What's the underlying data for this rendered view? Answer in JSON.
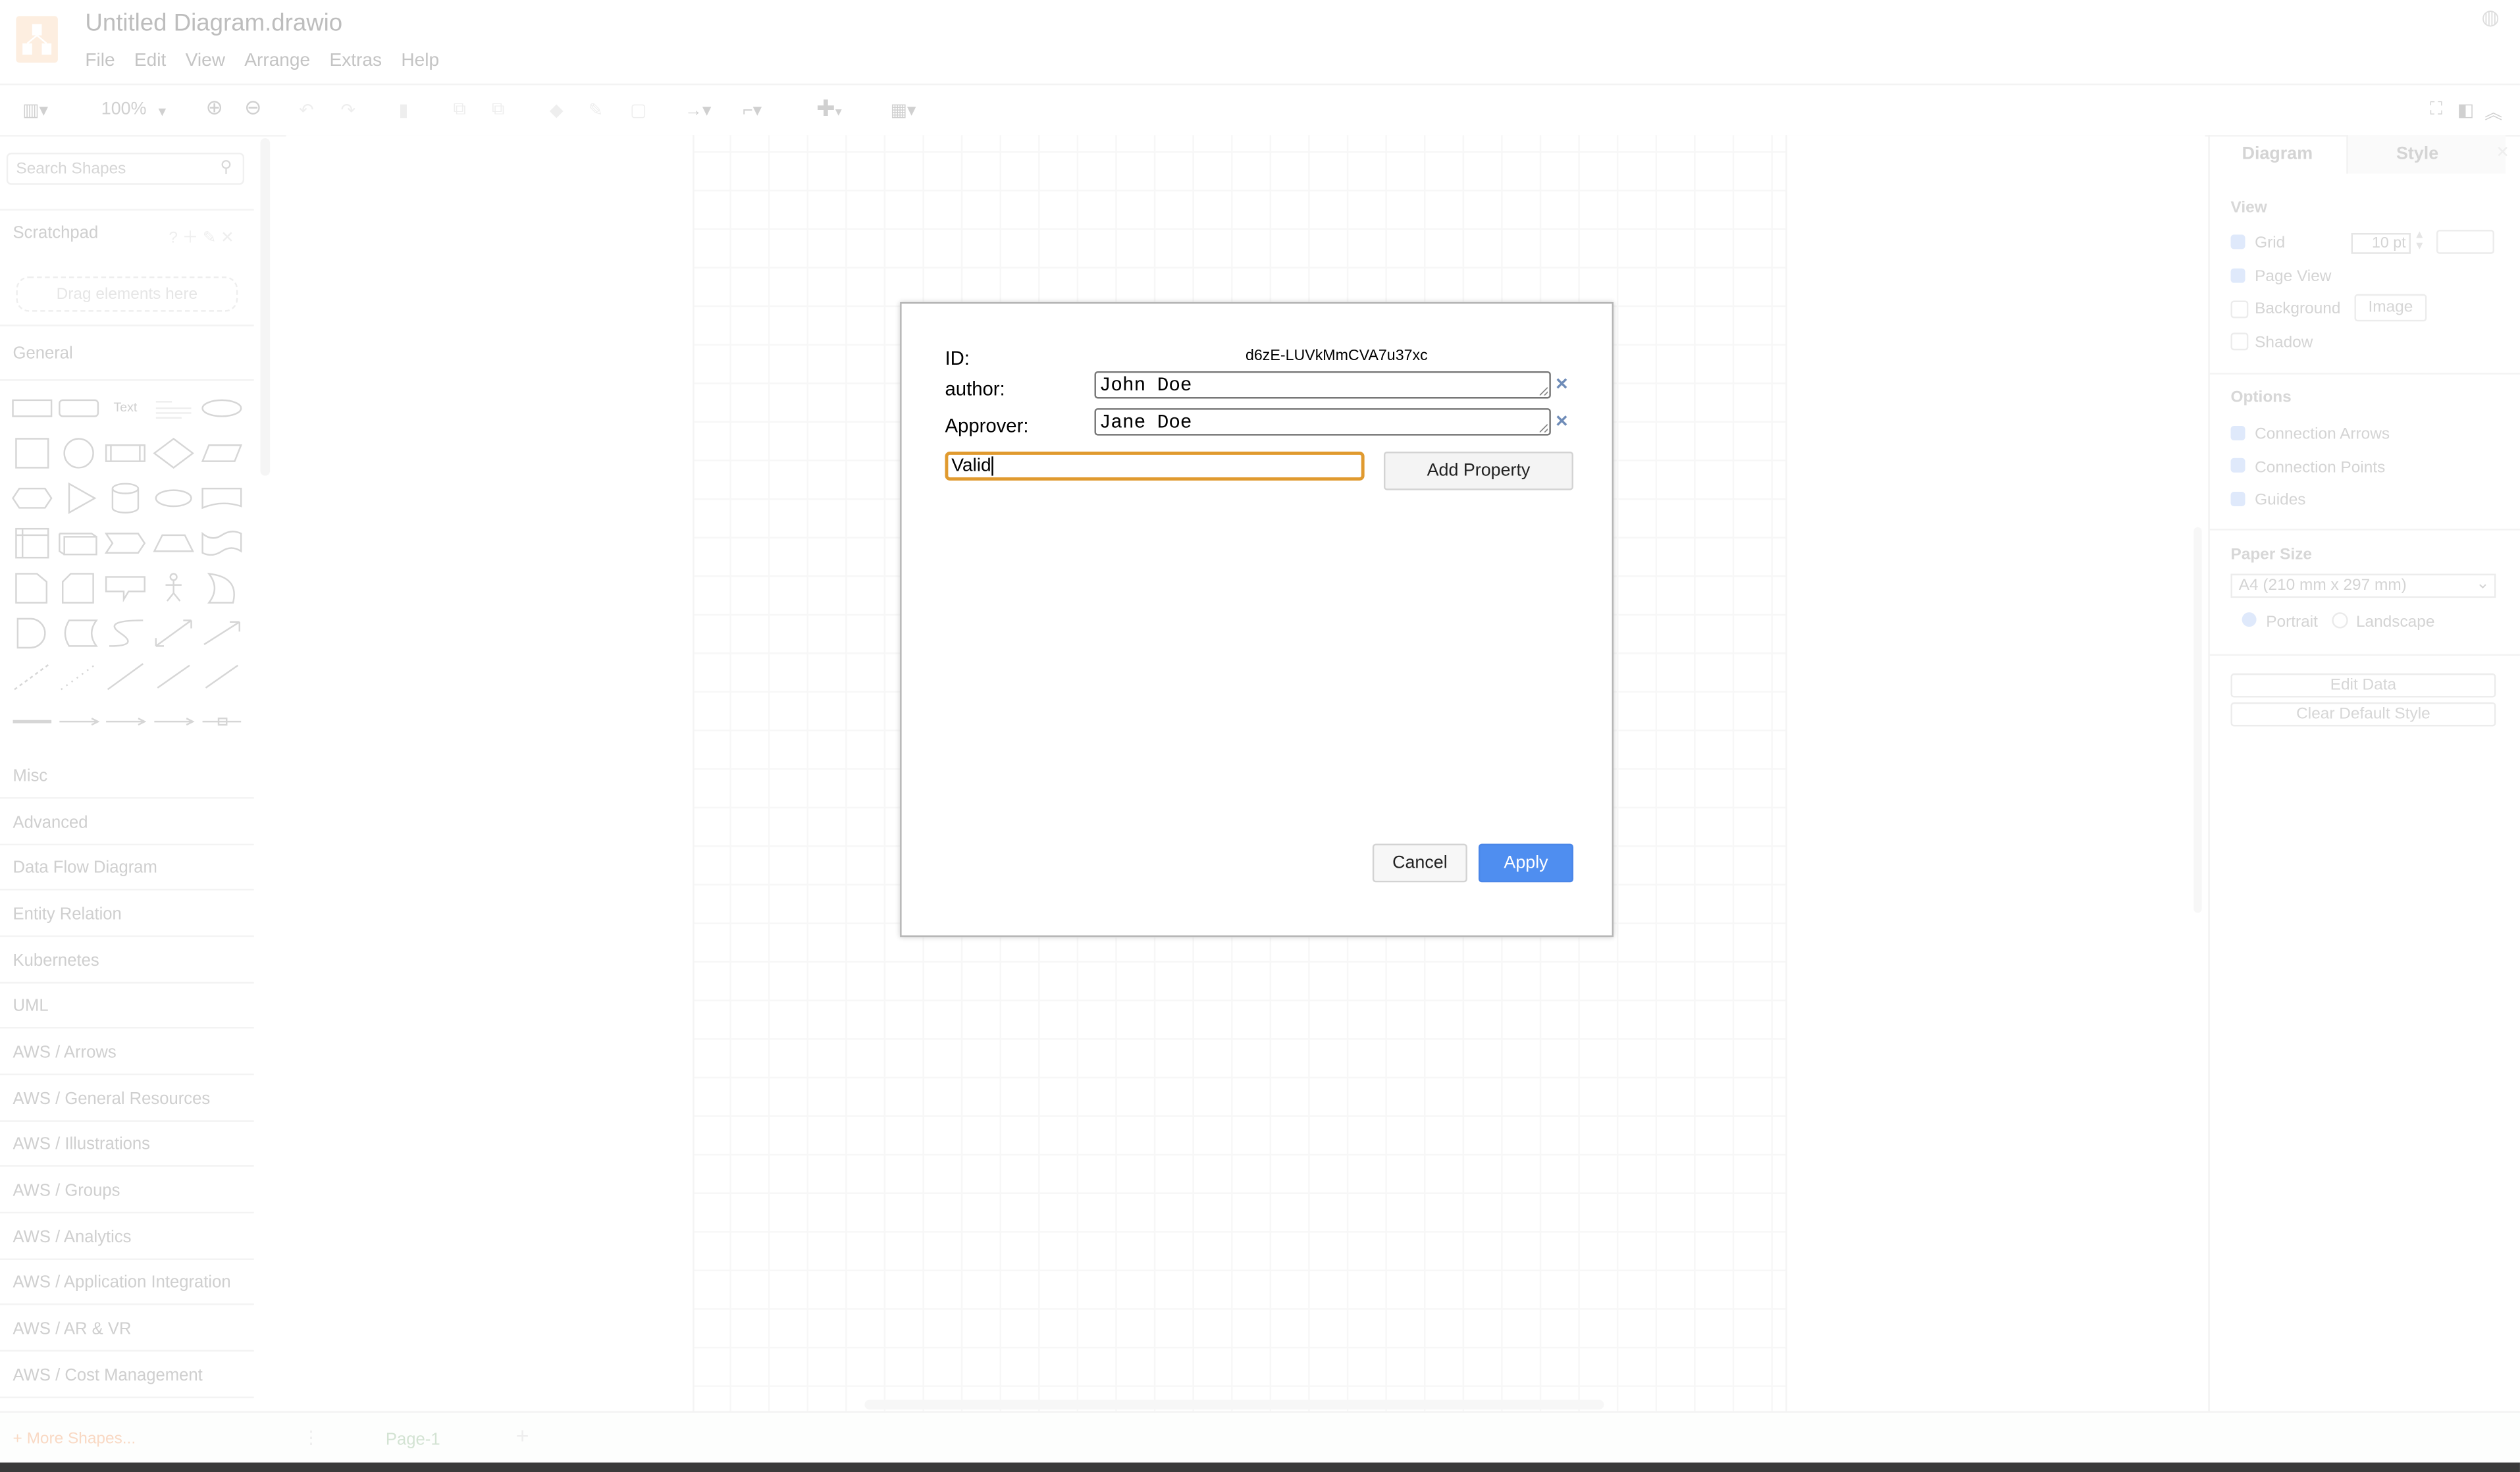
{
  "app": {
    "title": "Untitled Diagram.drawio",
    "brand_color": "#f08705"
  },
  "menu": [
    "File",
    "Edit",
    "View",
    "Arrange",
    "Extras",
    "Help"
  ],
  "toolbar": {
    "zoom": "100%"
  },
  "sidebar": {
    "search_placeholder": "Search Shapes",
    "scratchpad": {
      "title": "Scratchpad",
      "help": "?",
      "drop_hint": "Drag elements here"
    },
    "general": {
      "title": "General",
      "text_shape": "Text"
    },
    "shape_icons": [
      "rectangle",
      "rounded-rectangle",
      "text",
      "textbox",
      "ellipse",
      "square",
      "circle",
      "process",
      "diamond",
      "parallelogram",
      "hexagon",
      "triangle",
      "cylinder",
      "cloud",
      "document",
      "internal-storage",
      "cube",
      "step",
      "trapezoid",
      "tape",
      "note",
      "card",
      "callout",
      "actor",
      "or",
      "and",
      "data-storage",
      "curve",
      "bidirectional-arrow",
      "arrow",
      "dashed-line",
      "dotted-line",
      "line",
      "bidirectional-connector",
      "directional-connector",
      "link",
      "connector-label",
      "connector-2-labels",
      "connector-3-labels",
      "connector-symbol"
    ],
    "sections": [
      "Misc",
      "Advanced",
      "Data Flow Diagram",
      "Entity Relation",
      "Kubernetes",
      "UML",
      "AWS / Arrows",
      "AWS / General Resources",
      "AWS / Illustrations",
      "AWS / Groups",
      "AWS / Analytics",
      "AWS / Application Integration",
      "AWS / AR & VR",
      "AWS / Cost Management"
    ],
    "more_shapes": "+ More Shapes..."
  },
  "pages": {
    "tab": "Page-1",
    "add": "+"
  },
  "format_panel": {
    "tabs": [
      "Diagram",
      "Style"
    ],
    "view": {
      "title": "View",
      "grid": {
        "label": "Grid",
        "checked": true,
        "size": "10 pt"
      },
      "page_view": {
        "label": "Page View",
        "checked": true
      },
      "background": {
        "label": "Background",
        "checked": false,
        "button": "Image"
      },
      "shadow": {
        "label": "Shadow",
        "checked": false
      }
    },
    "options": {
      "title": "Options",
      "items": [
        {
          "label": "Connection Arrows",
          "checked": true
        },
        {
          "label": "Connection Points",
          "checked": true
        },
        {
          "label": "Guides",
          "checked": true
        }
      ]
    },
    "paper": {
      "title": "Paper Size",
      "selected": "A4 (210 mm x 297 mm)",
      "portrait": "Portrait",
      "landscape": "Landscape",
      "orientation": "Portrait"
    },
    "buttons": [
      "Edit Data",
      "Clear Default Style"
    ]
  },
  "dialog": {
    "id_label": "ID:",
    "id_value": "d6zE-LUVkMmCVA7u37xc",
    "properties": [
      {
        "name": "author:",
        "value": "John Doe"
      },
      {
        "name": "Approver:",
        "value": "Jane Doe"
      }
    ],
    "new_property_value": "Valid",
    "add_property": "Add Property",
    "cancel": "Cancel",
    "apply": "Apply",
    "accent": "#4f8ef0",
    "focus_color": "#e09a2f"
  }
}
